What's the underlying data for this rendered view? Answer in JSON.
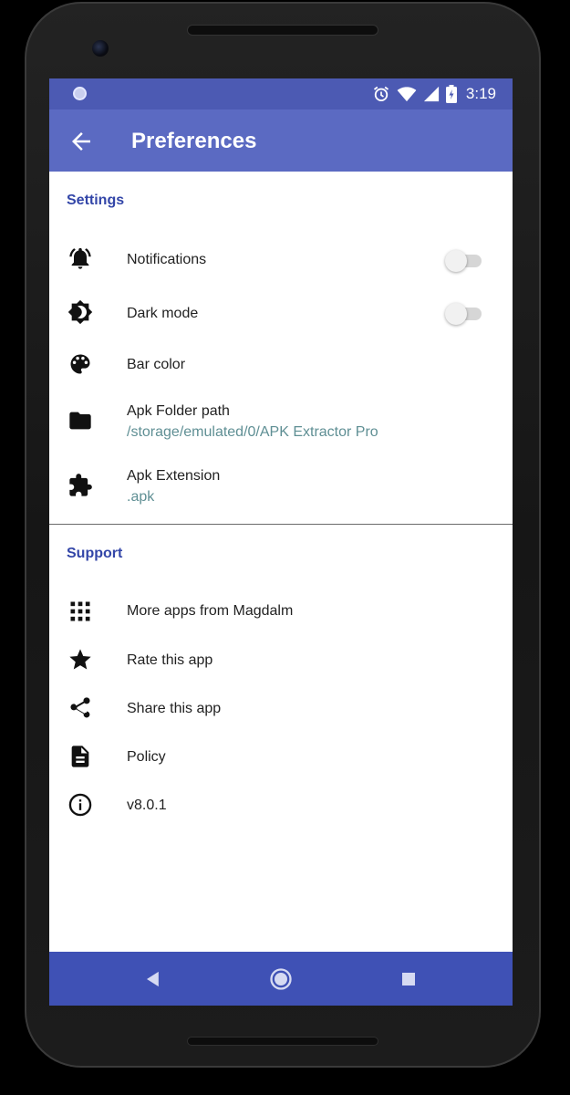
{
  "status_bar": {
    "time": "3:19",
    "icons": [
      "alarm-icon",
      "wifi-icon",
      "signal-icon",
      "battery-icon"
    ],
    "color": "#4c5ab3"
  },
  "app_bar": {
    "title": "Preferences",
    "back_icon": "arrow-back-icon",
    "color": "#5b6ac2"
  },
  "settings": {
    "header": "Settings",
    "items": [
      {
        "title": "Notifications",
        "icon": "bell-ring-icon",
        "toggle": false
      },
      {
        "title": "Dark mode",
        "icon": "brightness-icon",
        "toggle": false
      },
      {
        "title": "Bar color",
        "icon": "palette-icon"
      },
      {
        "title": "Apk Folder path",
        "subtitle": "/storage/emulated/0/APK Extractor Pro",
        "icon": "folder-icon"
      },
      {
        "title": "Apk Extension",
        "subtitle": ".apk",
        "icon": "puzzle-icon"
      }
    ]
  },
  "support": {
    "header": "Support",
    "items": [
      {
        "title": "More apps from Magdalm",
        "icon": "apps-grid-icon"
      },
      {
        "title": "Rate this app",
        "icon": "star-icon"
      },
      {
        "title": "Share this app",
        "icon": "share-icon"
      },
      {
        "title": "Policy",
        "icon": "document-icon"
      },
      {
        "title": "v8.0.1",
        "icon": "info-icon"
      }
    ]
  },
  "nav_bar": {
    "buttons": [
      "back-triangle-icon",
      "home-circle-icon",
      "recents-square-icon"
    ],
    "color": "#3f51b5"
  },
  "colors": {
    "section_header": "#3346a8",
    "subtitle": "#5f8f94"
  }
}
